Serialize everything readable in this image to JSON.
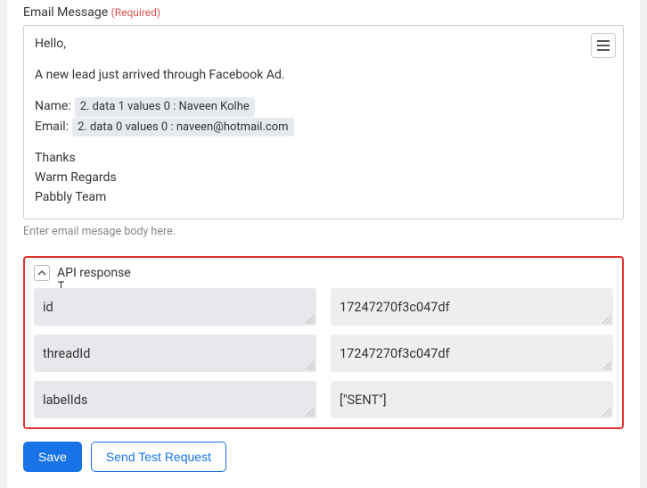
{
  "email_field": {
    "label": "Email Message",
    "required_text": "(Required)",
    "help": "Enter email mesage body here.",
    "body": {
      "greeting": "Hello,",
      "intro": "A new lead just arrived through Facebook Ad.",
      "name_label": "Name:",
      "name_token": "2. data 1 values 0 : Naveen Kolhe",
      "email_label": "Email:",
      "email_token": "2. data 0 values 0 : naveen@hotmail.com",
      "signoff1": "Thanks",
      "signoff2": "Warm Regards",
      "signoff3": "Pabbly Team"
    }
  },
  "api": {
    "title": "API response",
    "rows": [
      {
        "key": "id",
        "value": "17247270f3c047df"
      },
      {
        "key": "threadId",
        "value": "17247270f3c047df"
      },
      {
        "key": "labelIds",
        "value": "[\"SENT\"]"
      }
    ]
  },
  "buttons": {
    "save": "Save",
    "send_test": "Send Test Request"
  }
}
